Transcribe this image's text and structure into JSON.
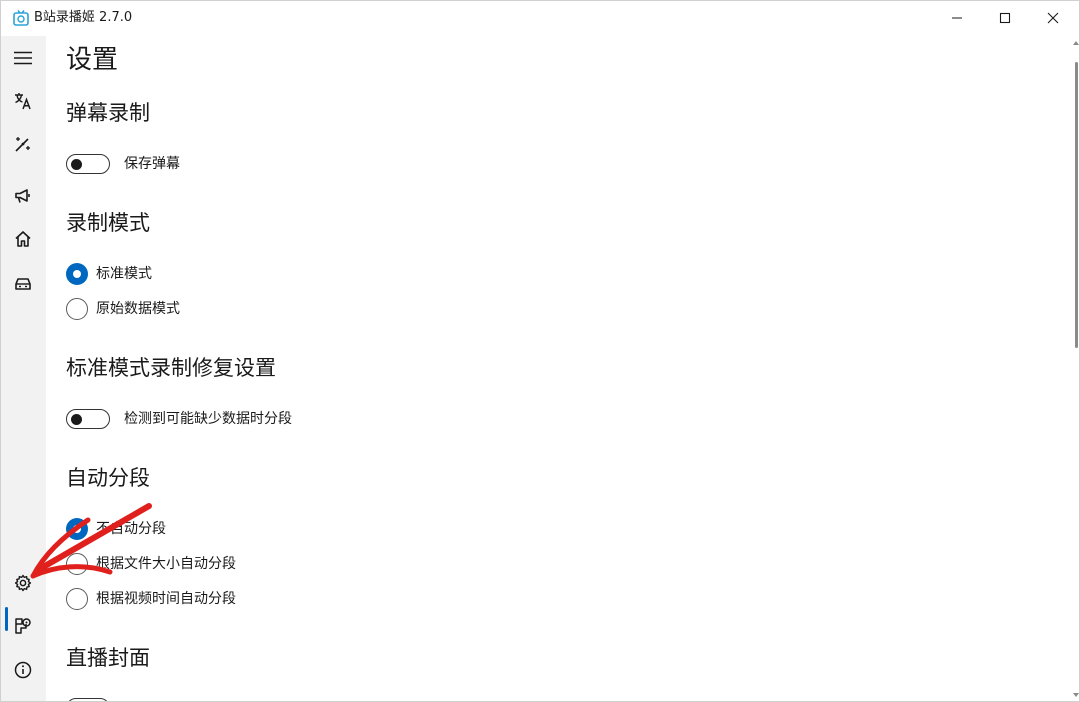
{
  "window": {
    "title": "B站录播姬 2.7.0",
    "accent": "#0067c0",
    "annotation_color": "#e0201c"
  },
  "controls": {
    "minimize": "minimize-icon",
    "maximize": "maximize-icon",
    "close": "close-icon"
  },
  "nav": {
    "items": [
      {
        "icon": "hamburger-menu-icon"
      },
      {
        "icon": "translate-icon"
      },
      {
        "icon": "magic-wand-icon"
      },
      {
        "icon": "megaphone-icon"
      },
      {
        "icon": "home-icon"
      },
      {
        "icon": "car-icon"
      },
      {
        "icon": "gear-icon",
        "selected": true
      },
      {
        "icon": "toolbox-icon"
      },
      {
        "icon": "info-icon"
      }
    ]
  },
  "page": {
    "title": "设置",
    "danmaku": {
      "heading": "弹幕录制",
      "save_danmaku": {
        "label": "保存弹幕",
        "on": false
      }
    },
    "record_mode": {
      "heading": "录制模式",
      "options": [
        "标准模式",
        "原始数据模式"
      ],
      "selected": "标准模式"
    },
    "repair": {
      "heading": "标准模式录制修复设置",
      "split_on_missing": {
        "label": "检测到可能缺少数据时分段",
        "on": false
      }
    },
    "auto_split": {
      "heading": "自动分段",
      "options": [
        "不自动分段",
        "根据文件大小自动分段",
        "根据视频时间自动分段"
      ],
      "selected": "不自动分段"
    },
    "cover": {
      "heading": "直播封面"
    }
  }
}
